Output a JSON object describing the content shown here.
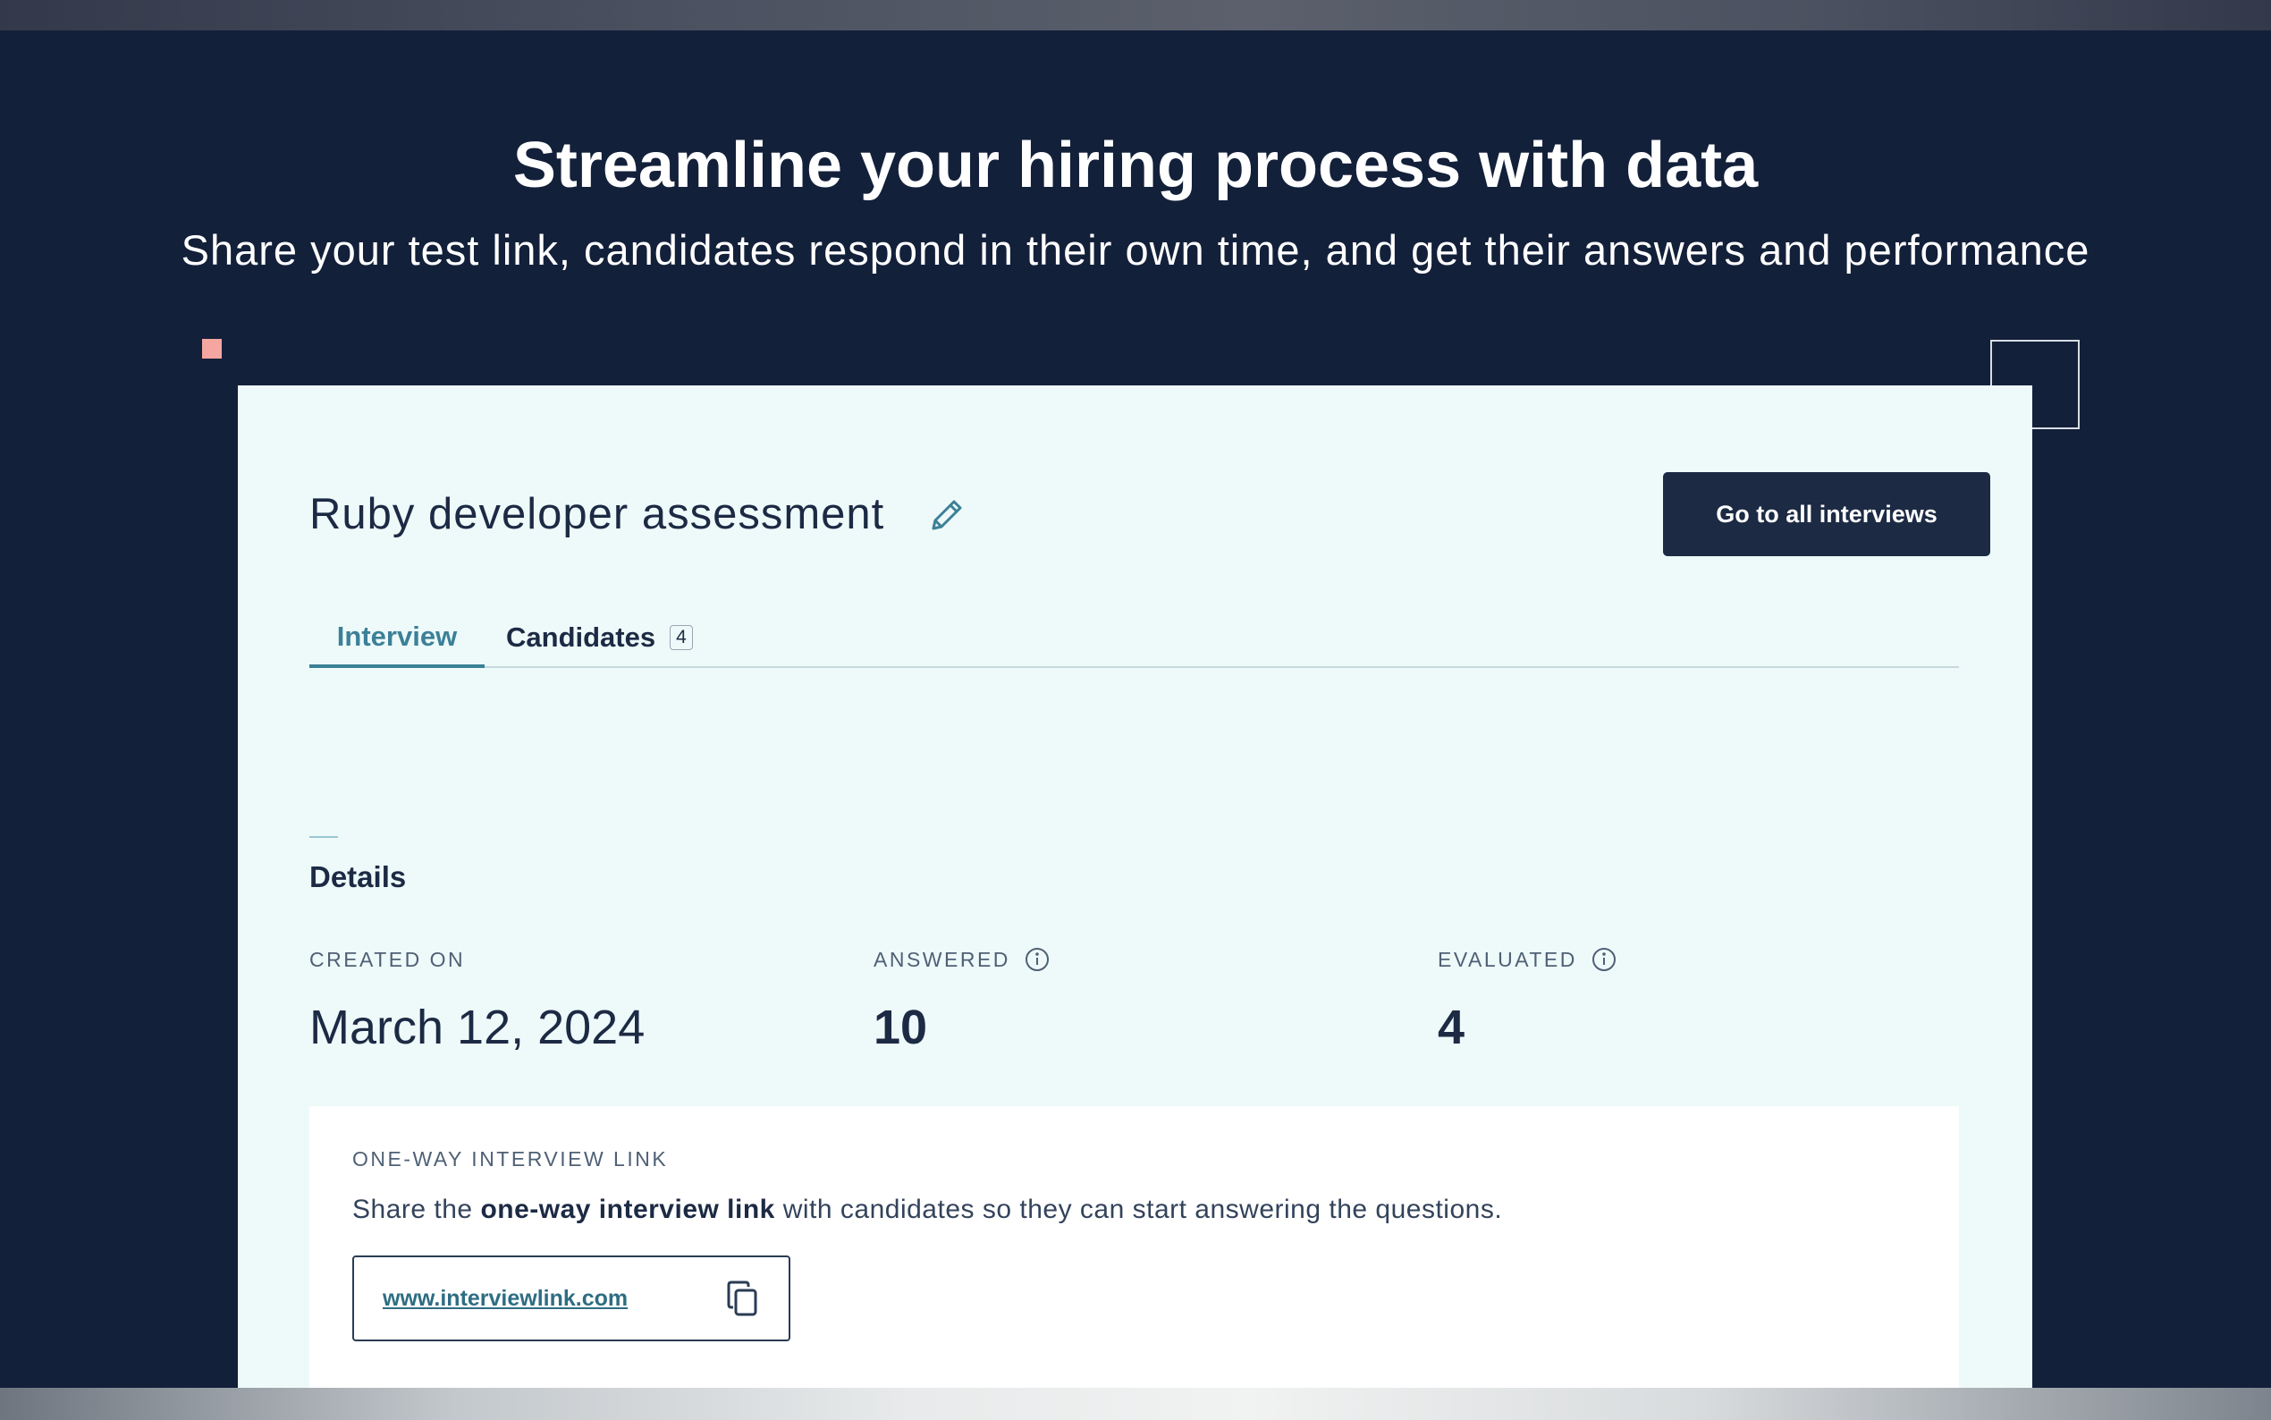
{
  "hero": {
    "title": "Streamline your hiring process with data",
    "subtitle": "Share your test link, candidates respond in their own time, and get their answers and performance"
  },
  "card": {
    "title": "Ruby developer assessment",
    "edit_icon": "pencil-icon",
    "go_button": "Go to all interviews",
    "tabs": [
      {
        "label": "Interview",
        "active": true
      },
      {
        "label": "Candidates",
        "count": "4",
        "active": false
      }
    ],
    "details": {
      "heading": "Details",
      "stats": [
        {
          "label": "CREATED ON",
          "value": "March 12, 2024"
        },
        {
          "label": "ANSWERED",
          "value": "10",
          "icon": "info-icon"
        },
        {
          "label": "EVALUATED",
          "value": "4",
          "icon": "info-icon"
        }
      ]
    },
    "link_panel": {
      "label": "ONE-WAY INTERVIEW LINK",
      "desc_prefix": "Share the",
      "desc_bold": "one-way interview link",
      "desc_suffix": "with candidates so they can start answering the questions.",
      "url": "www.interviewlink.com",
      "copy_icon": "copy-icon"
    }
  },
  "colors": {
    "background": "#13203a",
    "card": "#eefafa",
    "accent": "#3c8097",
    "dark": "#1c2a44",
    "deco_square": "#f5a6a0"
  }
}
